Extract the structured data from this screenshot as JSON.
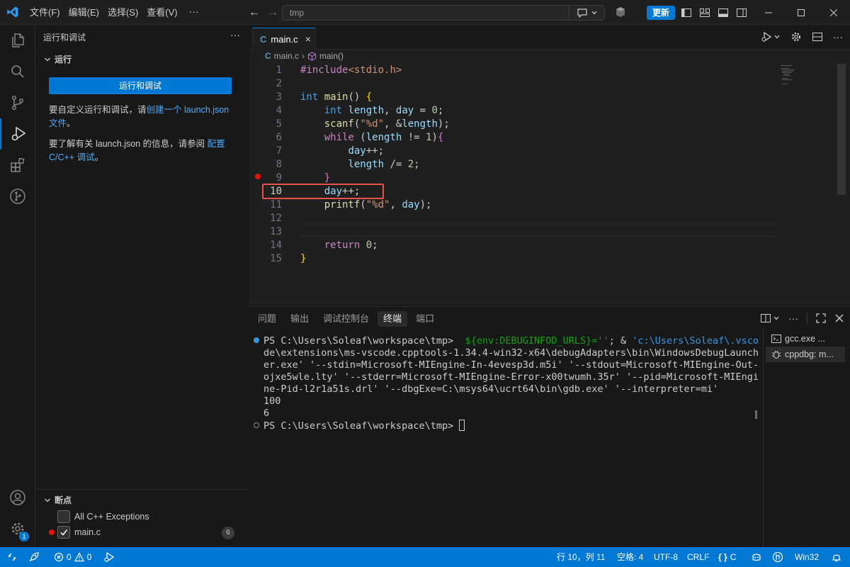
{
  "titlebar": {
    "menus": [
      "文件(F)",
      "编辑(E)",
      "选择(S)",
      "查看(V)"
    ],
    "more": "···",
    "search_text": "tmp",
    "update_label": "更新"
  },
  "sidebar": {
    "title": "运行和调试",
    "run_section": "运行",
    "run_button": "运行和调试",
    "help1_prefix": "要自定义运行和调试，请",
    "help1_link": "创建一个 launch.json 文件",
    "help1_suffix": "。",
    "help2_prefix": "要了解有关 launch.json 的信息，请参阅 ",
    "help2_link": "配置 C/C++ 调试",
    "help2_suffix": "。",
    "breakpoints_section": "断点",
    "breakpoints": [
      {
        "label": "All C++ Exceptions",
        "checked": false
      },
      {
        "label": "main.c",
        "checked": true
      }
    ],
    "breakpoint_count": "6",
    "settings_badge": "1"
  },
  "editor": {
    "tab_label": "main.c",
    "tab_icon": "C",
    "breadcrumb_file": "main.c",
    "breadcrumb_symbol": "main()",
    "line_numbers": [
      "1",
      "2",
      "3",
      "4",
      "5",
      "6",
      "7",
      "8",
      "9",
      "10",
      "11",
      "12",
      "13",
      "14",
      "15"
    ],
    "current_line_index": 9,
    "breakpoint_line_index": 5
  },
  "panel": {
    "tabs": [
      "问题",
      "输出",
      "调试控制台",
      "终端",
      "端口"
    ],
    "active_tab": "终端",
    "terminal_lines": [
      "PS C:\\Users\\Soleaf\\workspace\\tmp>",
      "${env:DEBUGINFOD_URLS}=''",
      "; & ",
      "'c:\\Users\\Soleaf\\.vsco",
      "de\\extensions\\ms-vscode.cpptools-1.34.4-win32-x64\\debugAdapters\\bin\\WindowsDebugLaunch",
      "er.exe' '--stdin=Microsoft-MIEngine-In-4evesp3d.m5i' '--stdout=Microsoft-MIEngine-Out-",
      "ojxe5wle.lty' '--stderr=Microsoft-MIEngine-Error-x00twumh.35r' '--pid=Microsoft-MIEngi",
      "ne-Pid-l2r1a51s.drl' '--dbgExe=C:\\msys64\\ucrt64\\bin\\gdb.exe' '--interpreter=mi'",
      "100",
      "6",
      "PS C:\\Users\\Soleaf\\workspace\\tmp>"
    ],
    "terminals": [
      "gcc.exe ...",
      "cppdbg: m..."
    ]
  },
  "statusbar": {
    "errors": "0",
    "warnings": "0",
    "position": "行 10，列 11",
    "spaces": "空格: 4",
    "encoding": "UTF-8",
    "eol": "CRLF",
    "language": "C",
    "platform": "Win32"
  },
  "colors": {
    "accent": "#0078d4",
    "breakpoint": "#e51400",
    "highlight_box": "#e5534b"
  }
}
